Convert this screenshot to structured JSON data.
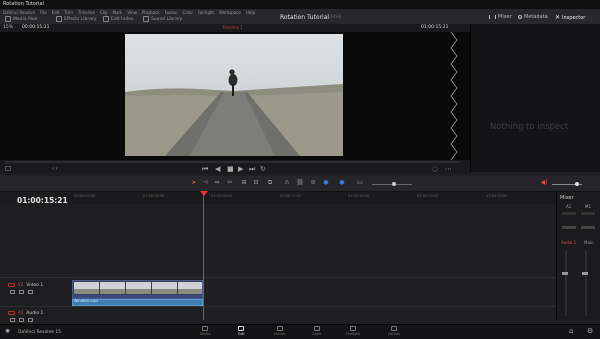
{
  "app": {
    "window_title": "Rotation Tutorial",
    "menu": [
      "DaVinci Resolve",
      "File",
      "Edit",
      "Trim",
      "Timeline",
      "Clip",
      "Mark",
      "View",
      "Playback",
      "Fusion",
      "Color",
      "Fairlight",
      "Workspace",
      "Help"
    ]
  },
  "toolbar": {
    "media_pool": "Media Pool",
    "effects_library": "Effects Library",
    "edit_index": "Edit Index",
    "sound_library": "Sound Library",
    "project_title": "Rotation Tutorial",
    "project_status": "Edited",
    "mixer": "Mixer",
    "metadata": "Metadata",
    "inspector": "Inspector"
  },
  "viewer": {
    "zoom": "15%",
    "source_timecode": "00:00:15:21",
    "timeline_name": "Timeline 1",
    "timeline_timecode": "01:00:15:21"
  },
  "inspector": {
    "empty_message": "Nothing to inspect"
  },
  "timeline": {
    "timecode": "01:00:15:21",
    "ruler_labels": [
      "01:00:00:00",
      "01:00:04:00",
      "01:00:08:00",
      "01:00:12:00",
      "01:00:16:00",
      "01:00:20:00",
      "01:00:24:00"
    ],
    "video_track": {
      "badge": "V1",
      "name": "Video 1"
    },
    "audio_track": {
      "badge": "A1",
      "name": "Audio 1"
    },
    "clip_name": "Windmill.mp4"
  },
  "mixer": {
    "title": "Mixer",
    "channel_a1": "A1",
    "channel_m1": "M1",
    "audio_label": "Audio 1",
    "main_label": "Main"
  },
  "bottom": {
    "app_name": "DaVinci Resolve 15",
    "pages": [
      {
        "label": "Media",
        "active": false
      },
      {
        "label": "Edit",
        "active": true
      },
      {
        "label": "Fusion",
        "active": false
      },
      {
        "label": "Color",
        "active": false
      },
      {
        "label": "Fairlight",
        "active": false
      },
      {
        "label": "Deliver",
        "active": false
      }
    ]
  },
  "colors": {
    "accent_red": "#d33333",
    "clip_blue": "#3e7fb0",
    "panel_bg": "#1f1f22"
  }
}
